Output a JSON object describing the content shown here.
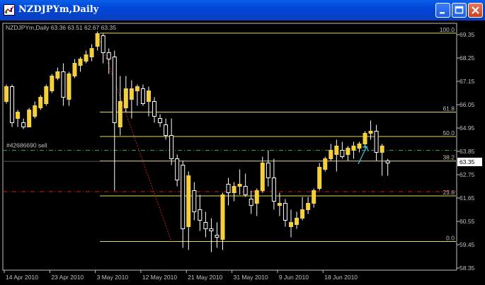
{
  "window": {
    "title": "NZDJPYm,Daily"
  },
  "chart_data": {
    "type": "candlestick",
    "header": "NZDJPYm,Daily  63.36 63.51 62.67 63.35",
    "ylim": [
      57.9,
      70.2
    ],
    "ytick_labels": [
      "69.35",
      "68.25",
      "67.15",
      "66.05",
      "64.95",
      "63.85",
      "62.75",
      "61.65",
      "60.55",
      "59.45",
      "58.35"
    ],
    "yticks": [
      69.35,
      68.25,
      67.15,
      66.05,
      64.95,
      63.85,
      62.75,
      61.65,
      60.55,
      59.45,
      58.35
    ],
    "xtick_labels": [
      "14 Apr 2010",
      "23 Apr 2010",
      "3 May 2010",
      "12 May 2010",
      "21 May 2010",
      "31 May 2010",
      "9 Jun 2010",
      "18 Jun 2010"
    ],
    "xtick_bar_index": [
      0,
      8,
      16,
      24,
      32,
      40,
      48,
      56
    ],
    "current_price": "63.35",
    "fib_levels": [
      {
        "label": "100.0",
        "value": 69.42
      },
      {
        "label": "61.8",
        "value": 65.7
      },
      {
        "label": "50.0",
        "value": 64.55
      },
      {
        "label": "38.2",
        "value": 63.4
      },
      {
        "label": "23.6",
        "value": 61.75
      },
      {
        "label": "0.0",
        "value": 59.6
      }
    ],
    "order_line": {
      "label": "#42686690 sell",
      "value": 63.9
    },
    "red_line_value": 61.95,
    "candles": [
      [
        66.2,
        67.0,
        66.1,
        66.9
      ],
      [
        66.9,
        67.0,
        65.0,
        65.2
      ],
      [
        65.4,
        65.8,
        65.0,
        65.7
      ],
      [
        65.2,
        65.4,
        64.9,
        65.0
      ],
      [
        65.0,
        65.9,
        65.0,
        65.8
      ],
      [
        65.5,
        66.2,
        65.4,
        66.0
      ],
      [
        65.9,
        66.5,
        65.8,
        66.4
      ],
      [
        66.1,
        67.0,
        66.0,
        66.9
      ],
      [
        66.7,
        67.5,
        66.6,
        67.4
      ],
      [
        67.3,
        67.8,
        67.2,
        67.6
      ],
      [
        67.6,
        68.0,
        66.0,
        66.4
      ],
      [
        66.3,
        67.6,
        66.0,
        67.5
      ],
      [
        67.4,
        68.2,
        67.3,
        68.0
      ],
      [
        67.9,
        68.3,
        67.6,
        68.2
      ],
      [
        68.1,
        68.6,
        68.0,
        68.4
      ],
      [
        68.3,
        68.9,
        68.1,
        68.7
      ],
      [
        68.8,
        69.5,
        68.6,
        69.4
      ],
      [
        69.3,
        69.4,
        68.0,
        68.5
      ],
      [
        68.5,
        68.7,
        67.5,
        68.2
      ],
      [
        68.3,
        68.6,
        62.0,
        65.2
      ],
      [
        65.0,
        67.4,
        64.6,
        66.2
      ],
      [
        65.9,
        67.4,
        65.7,
        66.8
      ],
      [
        66.3,
        67.2,
        65.4,
        66.8
      ],
      [
        66.7,
        67.0,
        66.0,
        66.9
      ],
      [
        66.8,
        67.0,
        66.0,
        66.1
      ],
      [
        66.2,
        66.9,
        65.5,
        66.7
      ],
      [
        66.2,
        66.4,
        65.2,
        65.5
      ],
      [
        65.4,
        65.6,
        65.0,
        65.2
      ],
      [
        65.1,
        65.4,
        64.4,
        64.6
      ],
      [
        64.6,
        65.4,
        63.2,
        63.5
      ],
      [
        63.5,
        63.7,
        62.2,
        62.5
      ],
      [
        63.2,
        63.4,
        59.3,
        60.2
      ],
      [
        60.3,
        62.9,
        59.2,
        62.7
      ],
      [
        62.0,
        62.4,
        60.6,
        61.0
      ],
      [
        61.1,
        61.8,
        60.1,
        60.6
      ],
      [
        60.5,
        61.0,
        59.8,
        60.2
      ],
      [
        60.2,
        60.7,
        59.1,
        60.1
      ],
      [
        59.9,
        60.5,
        59.3,
        59.8
      ],
      [
        59.7,
        61.9,
        59.2,
        61.8
      ],
      [
        62.3,
        62.6,
        61.3,
        61.9
      ],
      [
        61.9,
        62.4,
        61.5,
        62.2
      ],
      [
        62.2,
        63.0,
        61.8,
        62.3
      ],
      [
        62.2,
        62.8,
        61.7,
        61.8
      ],
      [
        61.6,
        62.0,
        60.9,
        61.3
      ],
      [
        61.4,
        62.1,
        60.8,
        62.0
      ],
      [
        62.0,
        63.6,
        61.9,
        63.3
      ],
      [
        63.3,
        63.9,
        62.2,
        62.6
      ],
      [
        62.6,
        63.5,
        61.1,
        61.5
      ],
      [
        61.3,
        61.9,
        60.8,
        61.4
      ],
      [
        61.4,
        61.6,
        60.3,
        60.6
      ],
      [
        60.3,
        61.1,
        59.8,
        60.5
      ],
      [
        60.4,
        61.0,
        60.2,
        60.7
      ],
      [
        60.7,
        61.7,
        60.6,
        61.1
      ],
      [
        61.1,
        61.7,
        60.9,
        61.4
      ],
      [
        61.4,
        62.1,
        61.2,
        62.0
      ],
      [
        62.1,
        63.3,
        62.0,
        63.1
      ],
      [
        63.0,
        63.6,
        62.9,
        63.5
      ],
      [
        63.5,
        64.2,
        63.4,
        63.9
      ],
      [
        63.7,
        64.4,
        62.9,
        64.1
      ],
      [
        63.9,
        64.3,
        63.5,
        63.6
      ],
      [
        63.7,
        64.1,
        63.4,
        64.0
      ],
      [
        63.9,
        64.3,
        63.5,
        64.1
      ],
      [
        64.0,
        64.3,
        63.8,
        64.2
      ],
      [
        64.2,
        64.8,
        64.0,
        64.7
      ],
      [
        64.7,
        65.3,
        64.4,
        64.8
      ],
      [
        64.8,
        65.1,
        63.4,
        63.8
      ],
      [
        63.8,
        64.2,
        62.7,
        64.1
      ],
      [
        63.4,
        63.5,
        62.7,
        63.3
      ]
    ]
  }
}
